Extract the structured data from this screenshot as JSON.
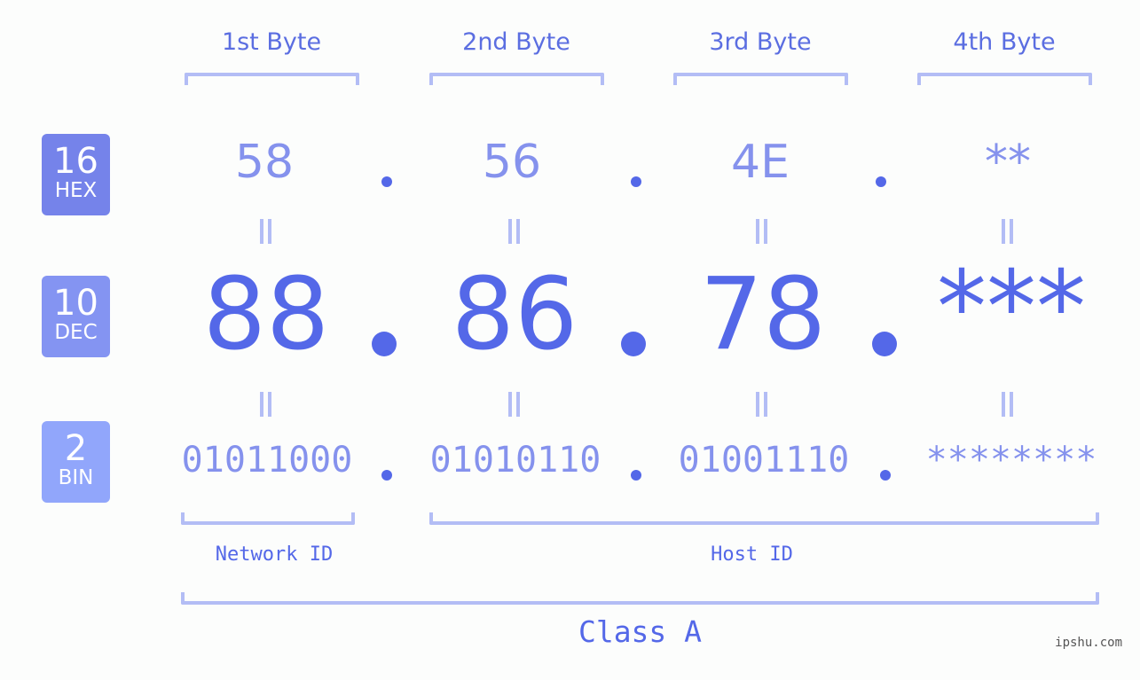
{
  "byte_headers": [
    "1st Byte",
    "2nd Byte",
    "3rd Byte",
    "4th Byte"
  ],
  "bases": {
    "hex": {
      "number": "16",
      "label": "HEX",
      "color": "#7583ea"
    },
    "dec": {
      "number": "10",
      "label": "DEC",
      "color": "#8494f2"
    },
    "bin": {
      "number": "2",
      "label": "BIN",
      "color": "#91a6fb"
    }
  },
  "hex_values": [
    "58",
    "56",
    "4E",
    "**"
  ],
  "dec_values": [
    "88",
    "86",
    "78",
    "***"
  ],
  "bin_values": [
    "01011000",
    "01010110",
    "01001110",
    "********"
  ],
  "sections": {
    "network_id": "Network ID",
    "host_id": "Host ID",
    "ip_class": "Class A"
  },
  "watermark": "ipshu.com",
  "colors": {
    "accent": "#5468e8",
    "light_value": "#8592ed",
    "bracket": "#b3bdf5",
    "background": "#fcfdfc"
  }
}
